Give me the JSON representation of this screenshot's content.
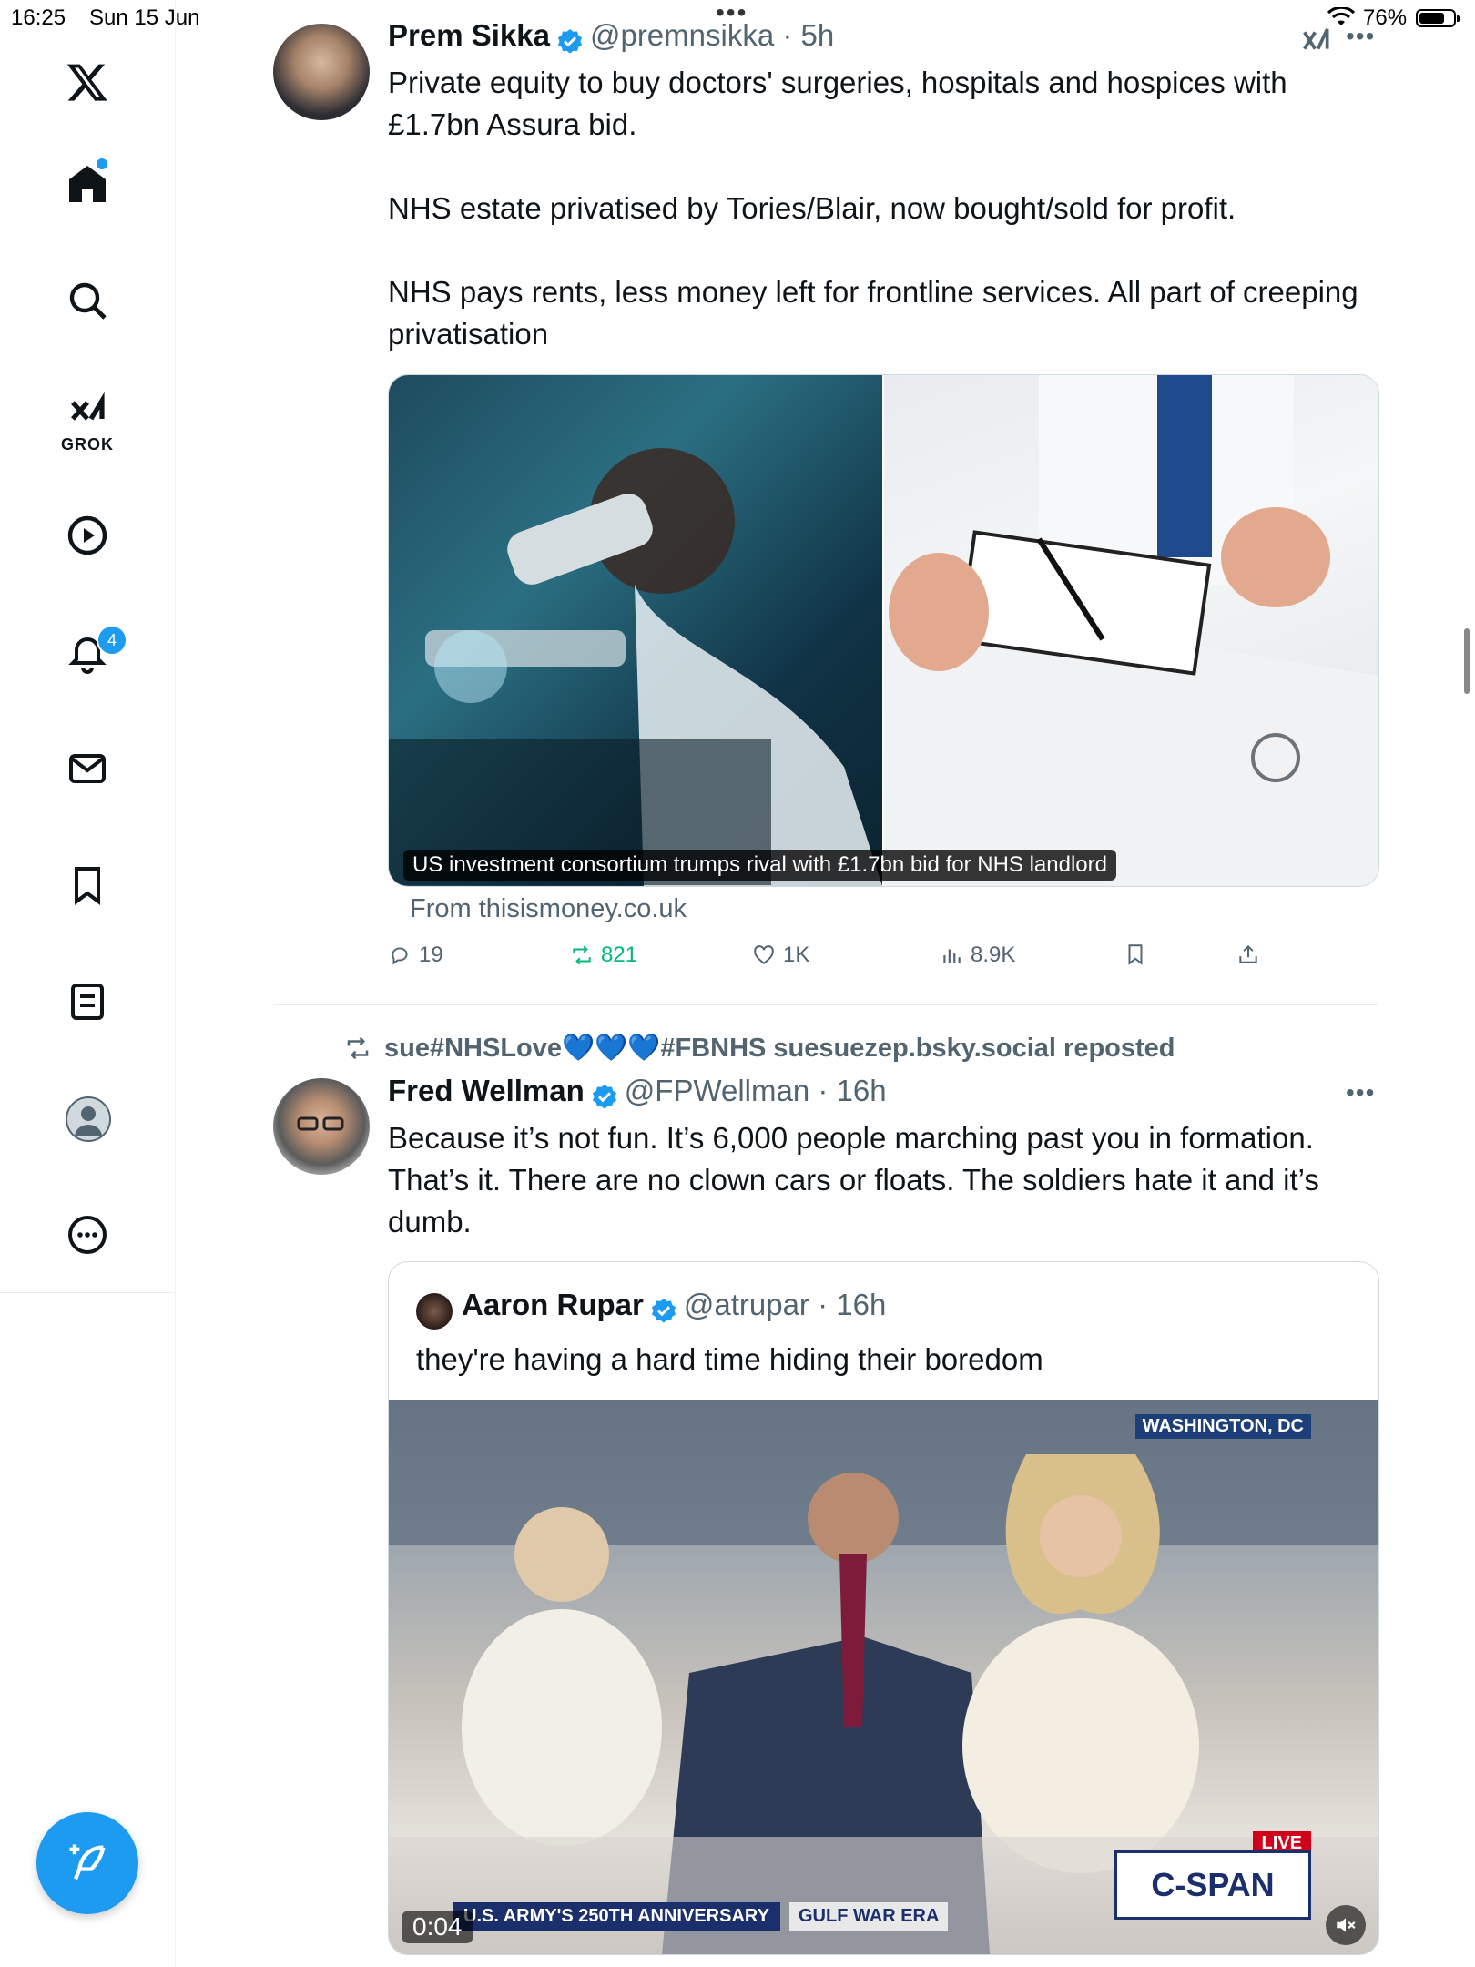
{
  "status_bar": {
    "time": "16:25",
    "date": "Sun 15 Jun",
    "battery": "76%",
    "battery_level": 0.76
  },
  "sidebar": {
    "items": [
      {
        "name": "x-logo",
        "label": "X"
      },
      {
        "name": "home"
      },
      {
        "name": "explore"
      },
      {
        "name": "grok",
        "label": "GROK"
      },
      {
        "name": "video"
      },
      {
        "name": "notifications",
        "badge": "4"
      },
      {
        "name": "messages"
      },
      {
        "name": "bookmarks"
      },
      {
        "name": "lists"
      },
      {
        "name": "profile"
      },
      {
        "name": "more"
      }
    ]
  },
  "tweets": [
    {
      "author": "Prem Sikka",
      "handle": "@premnsikka",
      "time": "5h",
      "verified": true,
      "text": "Private equity to buy doctors' surgeries, hospitals and hospices with £1.7bn Assura bid.\n\nNHS estate privatised by Tories/Blair, now bought/sold for profit.\n\nNHS pays rents, less money left for frontline services. All part of creeping privatisation",
      "card_caption": "US investment consortium trumps rival with £1.7bn bid for NHS landlord",
      "card_source": "From thisismoney.co.uk",
      "actions": {
        "replies": "19",
        "reposts": "821",
        "likes": "1K",
        "views": "8.9K"
      }
    },
    {
      "repost_by": "sue#NHSLove💙💙💙#FBNHS suesuezep.bsky.social reposted",
      "author": "Fred Wellman",
      "handle": "@FPWellman",
      "time": "16h",
      "verified": true,
      "text": "Because it’s not fun. It’s 6,000 people marching past you in formation. That’s it. There are no clown cars or floats. The soldiers hate it and it’s dumb.",
      "quote": {
        "author": "Aaron Rupar",
        "handle": "@atrupar",
        "time": "16h",
        "text": "they're having a hard time hiding their boredom",
        "video_time": "0:04",
        "overlay_location": "WASHINGTON, DC",
        "overlay_ticker": "U.S. ARMY'S 250TH ANNIVERSARY",
        "overlay_era": "GULF WAR ERA",
        "overlay_live": "LIVE",
        "overlay_network": "C-SPAN"
      }
    }
  ],
  "colors": {
    "accent": "#1d9bf0",
    "repost_green": "#00ba7c",
    "secondary_text": "#536471"
  }
}
